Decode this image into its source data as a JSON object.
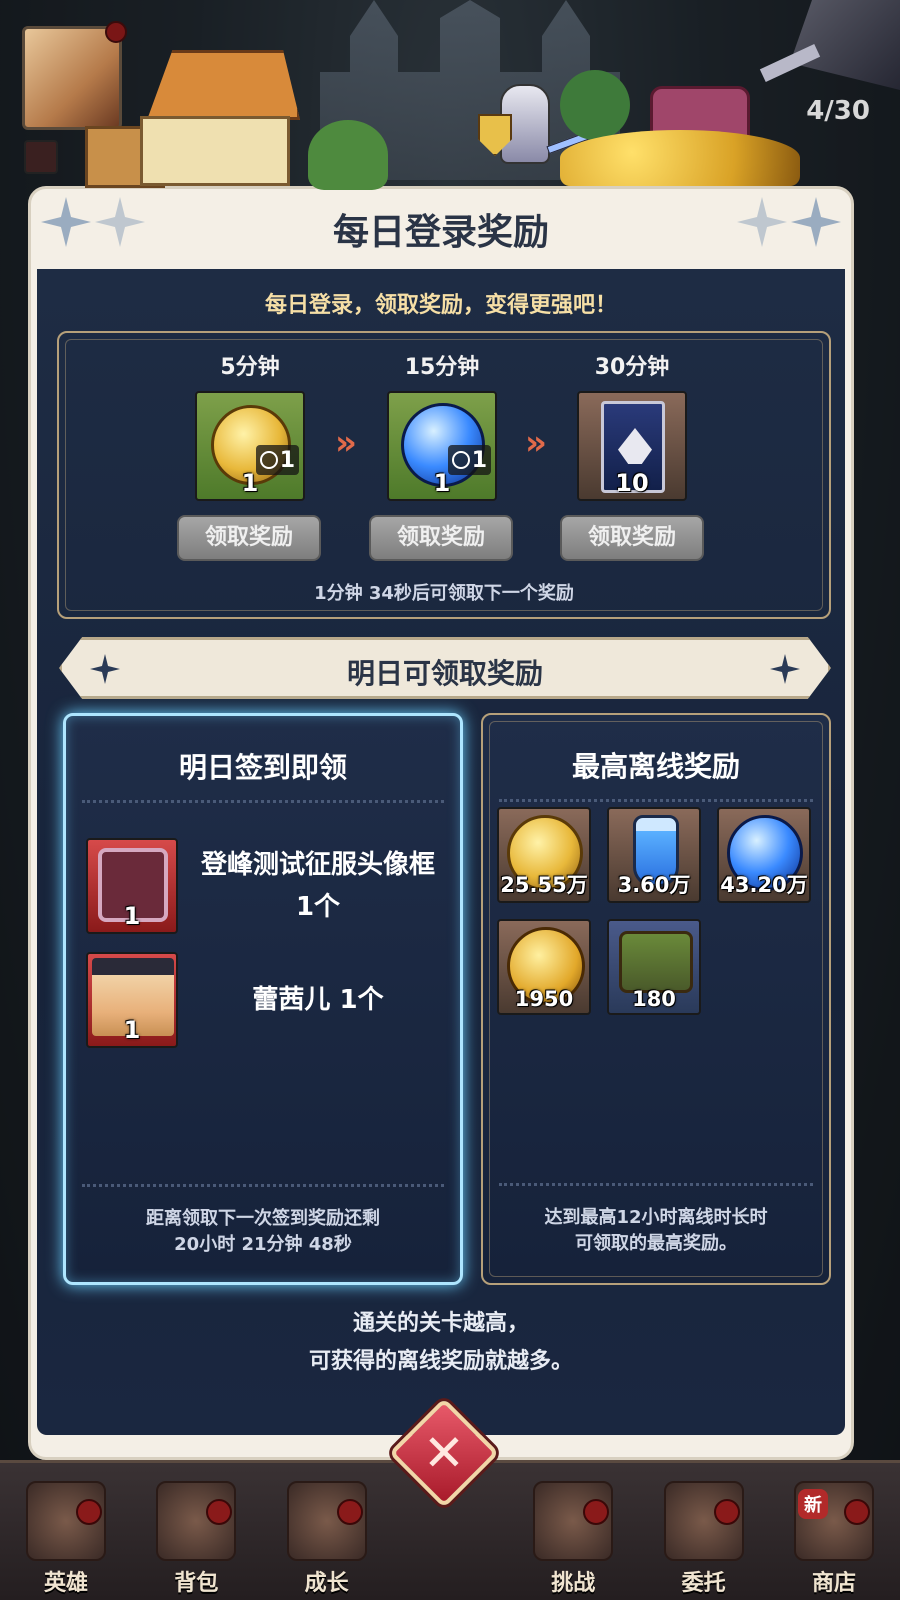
{
  "hud": {
    "stage_count": "4/30"
  },
  "dialog": {
    "title": "每日登录奖励",
    "subtitle": "每日登录，领取奖励，变得更强吧！",
    "online_rewards": [
      {
        "time": "5分钟",
        "icon": "gold-coin-icon",
        "qty": "1",
        "clock_qty": "1",
        "button": "领取奖励"
      },
      {
        "time": "15分钟",
        "icon": "blue-orb-icon",
        "qty": "1",
        "clock_qty": "1",
        "button": "领取奖励"
      },
      {
        "time": "30分钟",
        "icon": "card-pack-icon",
        "qty": "10",
        "button": "领取奖励"
      }
    ],
    "countdown": "1分钟 34秒后可领取下一个奖励",
    "tomorrow_banner": "明日可领取奖励",
    "signin": {
      "title": "明日签到即领",
      "items": [
        {
          "label": "登峰测试征服头像框 1个",
          "qty": "1",
          "icon": "avatar-frame-icon"
        },
        {
          "label": "蕾茜儿 1个",
          "qty": "1",
          "icon": "hero-portrait-icon"
        }
      ],
      "footer_line1": "距离领取下一次签到奖励还剩",
      "footer_line2": "20小时 21分钟 48秒"
    },
    "offline": {
      "title": "最高离线奖励",
      "items": [
        {
          "qty": "25.55万",
          "icon": "gold-coin-icon"
        },
        {
          "qty": "3.60万",
          "icon": "potion-icon"
        },
        {
          "qty": "43.20万",
          "icon": "blue-orb-icon"
        },
        {
          "qty": "1950",
          "icon": "face-coin-icon"
        },
        {
          "qty": "180",
          "icon": "treasure-chest-icon"
        }
      ],
      "footer_line1": "达到最高12小时离线时长时",
      "footer_line2": "可领取的最高奖励。"
    },
    "note_line1": "通关的关卡越高，",
    "note_line2": "可获得的离线奖励就越多。",
    "close_symbol": "✕"
  },
  "bottom_nav": [
    {
      "label": "英雄"
    },
    {
      "label": "背包"
    },
    {
      "label": "成长"
    },
    {
      "label": "挑战"
    },
    {
      "label": "委托"
    },
    {
      "label": "商店",
      "new_badge": "新"
    }
  ]
}
